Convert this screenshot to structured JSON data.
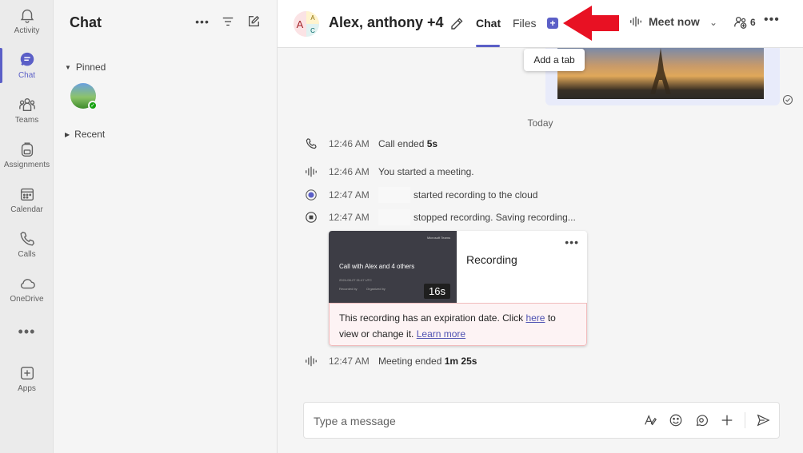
{
  "rail": {
    "items": [
      {
        "label": "Activity",
        "icon": "bell-icon"
      },
      {
        "label": "Chat",
        "icon": "chat-icon"
      },
      {
        "label": "Teams",
        "icon": "teams-icon"
      },
      {
        "label": "Assignments",
        "icon": "backpack-icon"
      },
      {
        "label": "Calendar",
        "icon": "calendar-icon"
      },
      {
        "label": "Calls",
        "icon": "phone-icon"
      },
      {
        "label": "OneDrive",
        "icon": "cloud-icon"
      }
    ],
    "more": "•••",
    "apps": {
      "label": "Apps",
      "icon": "plus-box-icon"
    }
  },
  "panel": {
    "title": "Chat",
    "sections": {
      "pinned": "Pinned",
      "recent": "Recent"
    }
  },
  "header": {
    "avatar_letters": [
      "A",
      "A",
      "C"
    ],
    "name": "Alex, anthony +4",
    "tabs": [
      "Chat",
      "Files"
    ],
    "add_tab": "+",
    "tooltip": "Add a tab",
    "meet_now": "Meet now",
    "participants_count": "6",
    "more": "•••"
  },
  "messages": {
    "date": "Today",
    "events": [
      {
        "time": "12:46 AM",
        "text": "Call ended ",
        "bold": "5s"
      },
      {
        "time": "12:46 AM",
        "text": "You started a meeting.",
        "bold": ""
      },
      {
        "time": "12:47 AM",
        "text": "started recording to the cloud",
        "bold": ""
      },
      {
        "time": "12:47 AM",
        "text": "stopped recording. Saving recording...",
        "bold": ""
      },
      {
        "time": "12:47 AM",
        "text": "Meeting ended ",
        "bold": "1m 25s"
      }
    ]
  },
  "recording": {
    "thumb_brand": "Microsoft Teams",
    "thumb_title": "Call with Alex and 4 others",
    "thumb_date": "2024-08-27 01:47 UTC",
    "thumb_meta1": "Recorded by",
    "thumb_meta2": "Organized by",
    "duration": "16s",
    "label": "Recording",
    "more": "•••",
    "notice_pre": "This recording has an expiration date. Click ",
    "notice_link1": "here",
    "notice_mid": " to view or change it. ",
    "notice_link2": "Learn more"
  },
  "compose": {
    "placeholder": "Type a message"
  },
  "colors": {
    "accent": "#5b5fc7",
    "arrow": "#e81123"
  }
}
